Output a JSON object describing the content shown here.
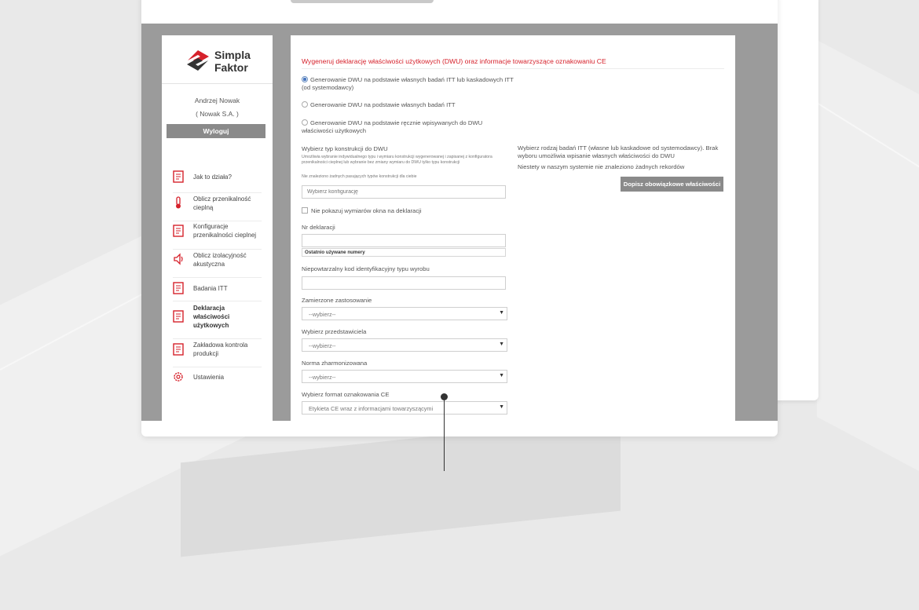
{
  "brand": {
    "line1": "Simpla",
    "line2": "Faktor",
    "color": "#d6212b"
  },
  "user": {
    "name": "Andrzej Nowak",
    "company": "( Nowak S.A. )",
    "logout_label": "Wyloguj"
  },
  "sidebar": {
    "items": [
      {
        "label": "Jak to działa?",
        "icon": "document-icon",
        "active": false
      },
      {
        "label": "Oblicz przenikalność cieplną",
        "icon": "thermometer-icon",
        "active": false
      },
      {
        "label": "Konfiguracje przenikalności cieplnej",
        "icon": "document-icon",
        "active": false
      },
      {
        "label": "Oblicz izolacyjność akustyczna",
        "icon": "speaker-icon",
        "active": false
      },
      {
        "label": "Badania ITT",
        "icon": "document-icon",
        "active": false
      },
      {
        "label": "Deklaracja właściwości użytkowych",
        "icon": "document-icon",
        "active": true
      },
      {
        "label": "Zakładowa kontrola produkcji",
        "icon": "document-icon",
        "active": false
      },
      {
        "label": "Ustawienia",
        "icon": "gear-icon",
        "active": false
      }
    ]
  },
  "form": {
    "heading": "Wygeneruj deklarację właściwości użytkowych (DWU) oraz informacje towarzyszące oznakowaniu CE",
    "options": [
      {
        "label": "Generowanie DWU na podstawie własnych badań ITT lub kaskadowych ITT (od systemodawcy)",
        "checked": true
      },
      {
        "label": "Generowanie DWU na podstawie własnych badań ITT",
        "checked": false
      },
      {
        "label": "Generowanie DWU na podstawie ręcznie wpisywanych do DWU właściwości użytkowych",
        "checked": false
      }
    ],
    "construction": {
      "label": "Wybierz typ konstrukcji do DWU",
      "hint": "Umożliwia wybranie indywidualnego typu i wymiaru konstrukcji wygenerowanej i zapisanej z konfiguratora przenikalności cieplnej lub wybranie bez zmiany wymiaru do DWU tylko typu konstrukcji",
      "empty": "Nie znaleziono żadnych pasujących typów konstrukcji dla ciebie",
      "placeholder": "Wybierz konfigurację"
    },
    "hide_window_dims": "Nie pokazuj wymiarów okna na deklaracji",
    "declaration_no": {
      "label": "Nr deklaracji",
      "value": "",
      "suggest": "Ostatnio używane numery"
    },
    "product_code": {
      "label": "Niepowtarzalny kod identyfikacyjny typu wyrobu",
      "value": ""
    },
    "intended_use": {
      "label": "Zamierzone zastosowanie",
      "selected": "--wybierz--"
    },
    "representative": {
      "label": "Wybierz przedstawiciela",
      "selected": "--wybierz--"
    },
    "norm": {
      "label": "Norma zharmonizowana",
      "selected": "--wybierz--"
    },
    "ce_format": {
      "label": "Wybierz format oznakowania CE",
      "selected": "Etykieta CE wraz z informacjami towarzyszącymi"
    }
  },
  "itt_panel": {
    "text": "Wybierz rodzaj badań ITT (własne lub kaskadowe od systemodawcy). Brak wyboru umożliwia wpisanie własnych właściwości do DWU",
    "no_records": "Niestety w naszym systemie nie znaleziono żadnych rekordów",
    "button_label": "Dopisz obowiązkowe właściwości"
  }
}
